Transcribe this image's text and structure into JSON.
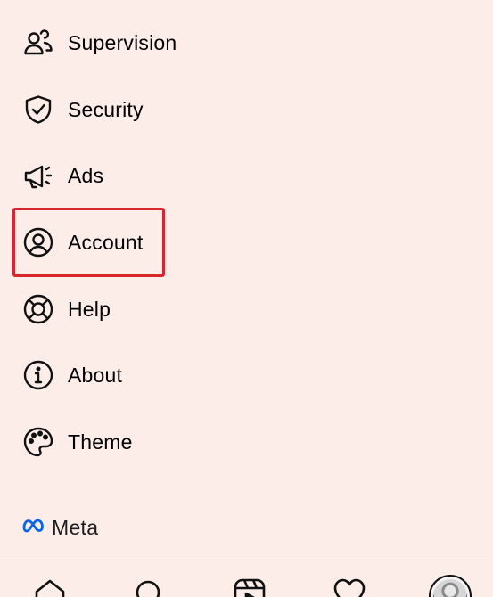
{
  "menu": {
    "items": [
      {
        "label": "Supervision",
        "icon": "supervision-icon"
      },
      {
        "label": "Security",
        "icon": "shield-check-icon"
      },
      {
        "label": "Ads",
        "icon": "megaphone-icon"
      },
      {
        "label": "Account",
        "icon": "account-circle-icon"
      },
      {
        "label": "Help",
        "icon": "lifebuoy-icon"
      },
      {
        "label": "About",
        "icon": "info-icon"
      },
      {
        "label": "Theme",
        "icon": "palette-icon"
      }
    ]
  },
  "highlight": {
    "target": "Account",
    "color": "#d9252b"
  },
  "footer": {
    "brand_text": "Meta",
    "brand_icon": "meta-infinity-icon",
    "brand_color": "#0a66e8"
  },
  "bottom_nav": {
    "items": [
      "home-icon",
      "search-icon",
      "reels-icon",
      "heart-icon",
      "profile-avatar"
    ]
  },
  "colors": {
    "background": "#fdede8",
    "text": "#000000"
  }
}
